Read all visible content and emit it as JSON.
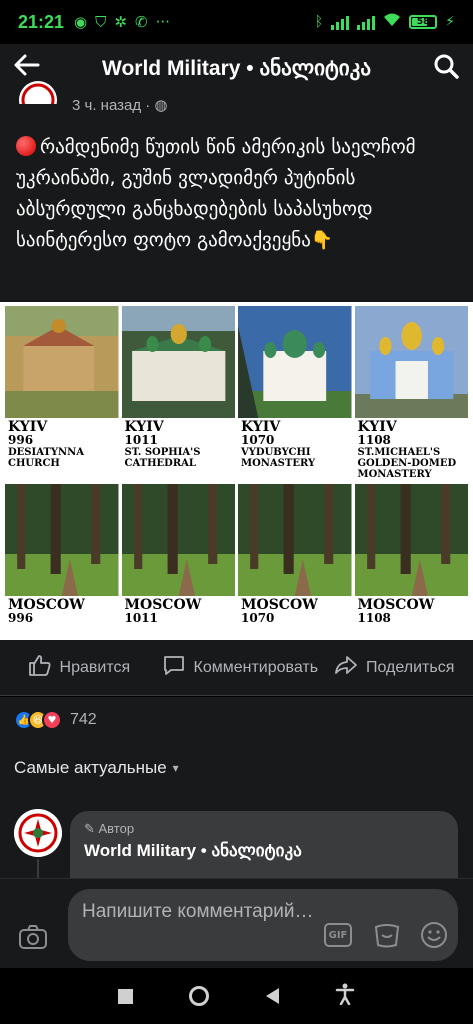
{
  "status": {
    "time": "21:21",
    "battery": "58"
  },
  "appbar": {
    "title": "World Military • ანალიტიკა"
  },
  "post": {
    "time": "3 ч. назад",
    "text": "რამდენიმე წუთის წინ ამერიკის საელჩომ უკრაინაში, გუშინ ვლადიმერ პუტინის აბსურდული განცხადებების საპასუხოდ საინტერესო ფოტო გამოაქვეყნა",
    "pointing_emoji": "👇"
  },
  "image": {
    "kyiv": [
      {
        "city": "KYIV",
        "year": "996",
        "name": "DESIATYNNA CHURCH"
      },
      {
        "city": "KYIV",
        "year": "1011",
        "name": "ST. SOPHIA'S CATHEDRAL"
      },
      {
        "city": "KYIV",
        "year": "1070",
        "name": "VYDUBYCHI MONASTERY"
      },
      {
        "city": "KYIV",
        "year": "1108",
        "name": "ST.MICHAEL'S GOLDEN-DOMED MONASTERY"
      }
    ],
    "moscow": [
      {
        "city": "MOSCOW",
        "year": "996"
      },
      {
        "city": "MOSCOW",
        "year": "1011"
      },
      {
        "city": "MOSCOW",
        "year": "1070"
      },
      {
        "city": "MOSCOW",
        "year": "1108"
      }
    ]
  },
  "actions": {
    "like": "Нравится",
    "comment": "Комментировать",
    "share": "Поделиться"
  },
  "reactions": {
    "count": "742"
  },
  "sort": {
    "label": "Самые актуальные"
  },
  "comment": {
    "role": "Автор",
    "name": "World Military • ანალიტიკა"
  },
  "composer": {
    "placeholder": "Напишите комментарий…",
    "gif": "GIF"
  },
  "colors": {
    "accent_green": "#3ddc5a",
    "bg": "#18191a",
    "bubble": "#3a3b3c"
  }
}
